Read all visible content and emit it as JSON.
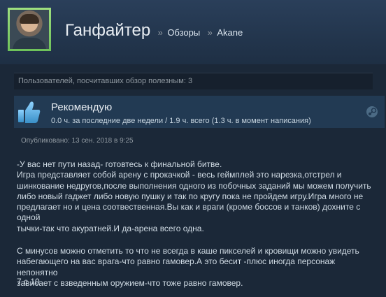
{
  "header": {
    "app_name": "Ганфайтер",
    "crumb_sep": "»",
    "crumbs": [
      "Обзоры",
      "Akane"
    ]
  },
  "helpful": {
    "text": "Пользователей, посчитавших обзор полезным: 3"
  },
  "review": {
    "verdict": "Рекомендую",
    "hours": "0.0 ч. за последние две недели / 1.9 ч. всего (1.3 ч. в момент написания)",
    "posted": "Опубликовано: 13 сен. 2018 в 9:25",
    "paragraphs": [
      [
        "-У вас нет пути назад- готовтесь к финальной битве.",
        "Игра представляет собой арену с прокачкой - весь геймплей это нарезка,отстрел и",
        "шинкование недругов,после выполнения одного из побочных заданий мы можем получить",
        "либо новый гаджет либо новую пушку и так по кругу пока не пройдем игру.Игра много не",
        "предлагает но и цена соотвественная.Вы как и враги (кроме боссов и танков) дохните с одной",
        "тычки-так что акуратней.И да-арена всего одна."
      ],
      [
        "С минусов можно отметить то что не всегда в каше пикселей и кровищи можно увидеть",
        "набегающего на вас врага-что равно гамовер.А это бесит -плюс иногда персонаж непонятно",
        "зависает с взведенным оружием-что тоже равно гамовер."
      ]
    ],
    "score": "7 с 10"
  },
  "colors": {
    "background": "#1b2838",
    "header": "#2a3f5a",
    "review_box": "#223a53",
    "thumb_blue": "#66c0f4",
    "avatar_frame": "#8fd46c"
  },
  "icons": {
    "thumb": "thumbs-up-icon",
    "steam": "steam-logo-icon"
  }
}
